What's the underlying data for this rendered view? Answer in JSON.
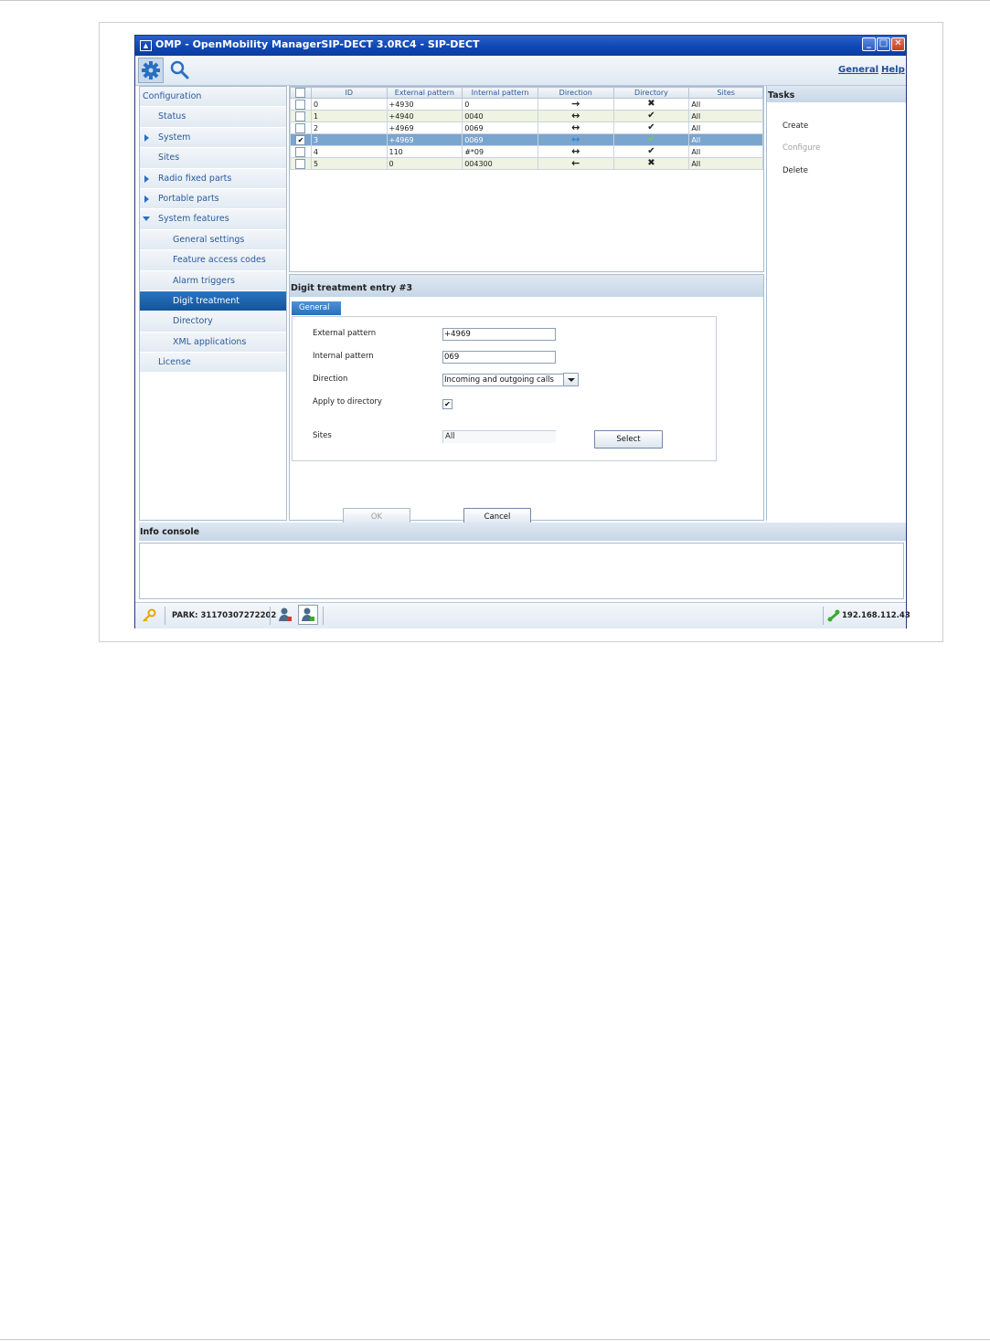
{
  "window": {
    "title": "OMP - OpenMobility ManagerSIP-DECT 3.0RC4 - SIP-DECT",
    "app_icon": "omp-icon",
    "controls": [
      "minimize",
      "maximize",
      "close"
    ]
  },
  "toolbar": {
    "icons": [
      "gear-icon",
      "search-icon"
    ],
    "links": {
      "general": "General",
      "help": "Help"
    }
  },
  "nav": {
    "root": "Configuration",
    "items": [
      {
        "label": "Status",
        "level": 1,
        "arrow": "none"
      },
      {
        "label": "System",
        "level": 1,
        "arrow": "right"
      },
      {
        "label": "Sites",
        "level": 1,
        "arrow": "none"
      },
      {
        "label": "Radio fixed parts",
        "level": 1,
        "arrow": "right"
      },
      {
        "label": "Portable parts",
        "level": 1,
        "arrow": "right"
      },
      {
        "label": "System features",
        "level": 1,
        "arrow": "down"
      },
      {
        "label": "General settings",
        "level": 2,
        "arrow": "none"
      },
      {
        "label": "Feature access codes",
        "level": 2,
        "arrow": "none"
      },
      {
        "label": "Alarm triggers",
        "level": 2,
        "arrow": "none"
      },
      {
        "label": "Digit treatment",
        "level": 2,
        "arrow": "none",
        "selected": true
      },
      {
        "label": "Directory",
        "level": 2,
        "arrow": "none"
      },
      {
        "label": "XML applications",
        "level": 2,
        "arrow": "none"
      },
      {
        "label": "License",
        "level": 1,
        "arrow": "none"
      }
    ]
  },
  "table": {
    "columns": [
      "ID",
      "External pattern",
      "Internal pattern",
      "Direction",
      "Directory",
      "Sites"
    ],
    "rows": [
      {
        "checked": false,
        "id": "0",
        "external": "+4930",
        "internal": "0",
        "direction": "→",
        "directory": "✖",
        "sites": "All"
      },
      {
        "checked": false,
        "id": "1",
        "external": "+4940",
        "internal": "0040",
        "direction": "↔",
        "directory": "✔",
        "sites": "All"
      },
      {
        "checked": false,
        "id": "2",
        "external": "+4969",
        "internal": "0069",
        "direction": "↔",
        "directory": "✔",
        "sites": "All"
      },
      {
        "checked": true,
        "id": "3",
        "external": "+4969",
        "internal": "0069",
        "direction": "↔",
        "directory": "✔",
        "sites": "All"
      },
      {
        "checked": false,
        "id": "4",
        "external": "110",
        "internal": "#*09",
        "direction": "↔",
        "directory": "✔",
        "sites": "All"
      },
      {
        "checked": false,
        "id": "5",
        "external": "0",
        "internal": "004300",
        "direction": "←",
        "directory": "✖",
        "sites": "All"
      }
    ]
  },
  "detail": {
    "header": "Digit treatment entry #3",
    "tab": "General",
    "form": {
      "external_pattern_label": "External pattern",
      "external_pattern_value": "+4969",
      "internal_pattern_label": "Internal pattern",
      "internal_pattern_value": "069",
      "direction_label": "Direction",
      "direction_value": "Incoming and outgoing calls",
      "apply_label": "Apply to directory",
      "apply_checked": "✔",
      "sites_label": "Sites",
      "sites_value": "All",
      "select_button": "Select"
    },
    "ok_button": "OK",
    "cancel_button": "Cancel"
  },
  "tasks": {
    "header": "Tasks",
    "create": "Create",
    "configure": "Configure",
    "delete": "Delete"
  },
  "info_console": {
    "header": "Info console"
  },
  "statusbar": {
    "key_icon": "key-icon",
    "park": "PARK: 31170307272202",
    "icons": [
      "user-red-icon",
      "user-green-icon",
      "network-icon"
    ],
    "ip": "192.168.112.43"
  },
  "colors": {
    "titlebar": "#0f47b4",
    "nav_selected": "#1a5fa8",
    "row_selected": "#7aa5cf",
    "accent": "#2a6fc0"
  }
}
